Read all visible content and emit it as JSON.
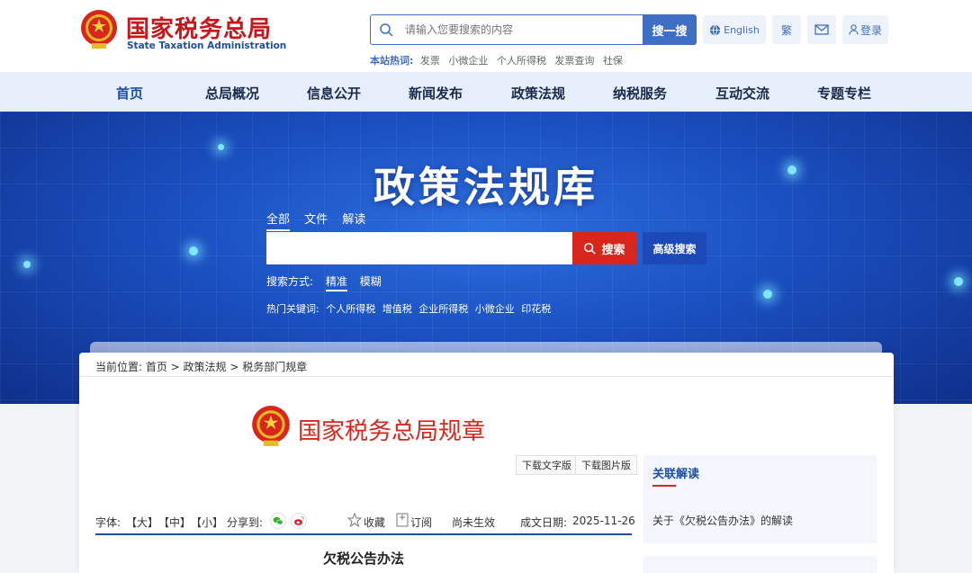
{
  "header": {
    "logo_cn": "国家税务总局",
    "logo_en": "State Taxation Administration",
    "search_placeholder": "请输入您要搜索的内容",
    "search_button": "搜一搜",
    "hot_label": "本站热词:",
    "hot_words": [
      "发票",
      "小微企业",
      "个人所得税",
      "发票查询",
      "社保"
    ],
    "english": "English",
    "traditional": "繁",
    "login": "登录"
  },
  "nav": {
    "items": [
      "首页",
      "总局概况",
      "信息公开",
      "新闻发布",
      "政策法规",
      "纳税服务",
      "互动交流",
      "专题专栏"
    ],
    "active_index": 0
  },
  "banner": {
    "title": "政策法规库",
    "tabs": [
      "全部",
      "文件",
      "解读"
    ],
    "active_tab": 0,
    "search_value": "",
    "search_button": "搜索",
    "advanced_button": "高级搜索",
    "mode_label": "搜索方式:",
    "modes": [
      "精准",
      "模糊"
    ],
    "active_mode": 0,
    "hot_label": "热门关键词:",
    "hot_words": [
      "个人所得税",
      "增值税",
      "企业所得税",
      "小微企业",
      "印花税"
    ]
  },
  "content": {
    "breadcrumb": "当前位置: 首页 > 政策法规 > 税务部门规章",
    "doc_series": "国家税务总局规章",
    "download_text": "下载文字版",
    "download_image": "下载图片版",
    "font_label": "字体:",
    "font_large": "【大】",
    "font_medium": "【中】",
    "font_small": "【小】",
    "share_label": "分享到:",
    "favorite": "收藏",
    "subscribe": "订阅",
    "status": "尚未生效",
    "date_label": "成文日期:",
    "date": "2025-11-26",
    "doc_title": "欠税公告办法"
  },
  "sidebar": {
    "related_title": "关联解读",
    "related_link": "关于《欠税公告办法》的解读"
  },
  "colors": {
    "brand_red": "#c8161d",
    "brand_blue": "#1f4fa0",
    "search_blue": "#3f6fc4"
  }
}
